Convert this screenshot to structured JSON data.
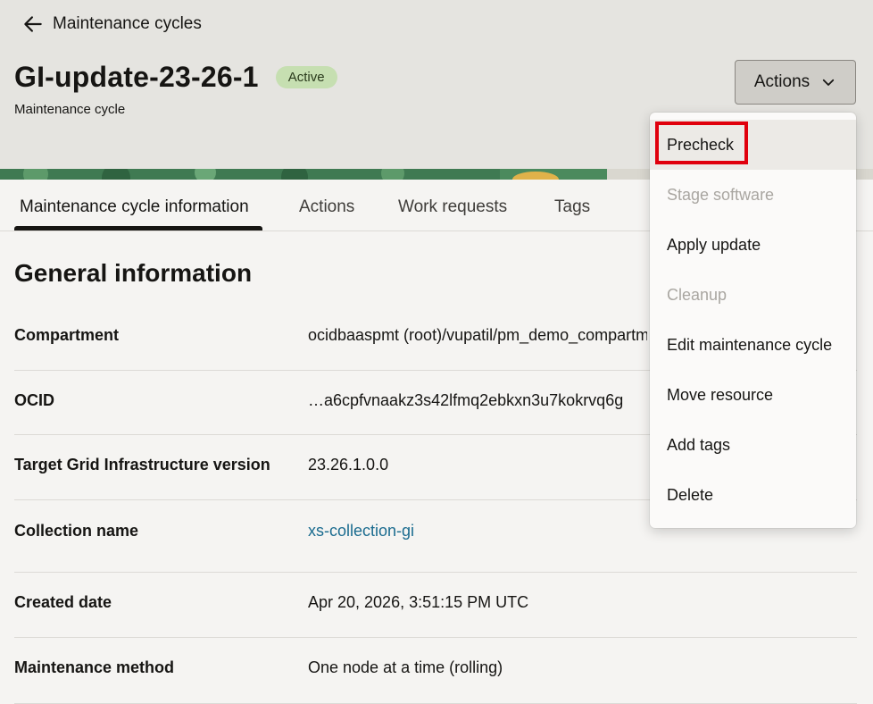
{
  "header": {
    "back_label": "Maintenance cycles",
    "title": "GI-update-23-26-1",
    "status": "Active",
    "subtitle": "Maintenance cycle",
    "actions_label": "Actions"
  },
  "tabs": [
    {
      "label": "Maintenance cycle information",
      "active": true
    },
    {
      "label": "Actions"
    },
    {
      "label": "Work requests"
    },
    {
      "label": "Tags"
    }
  ],
  "general": {
    "title": "General information",
    "rows": [
      {
        "label": "Compartment",
        "value": "ocidbaaspmt (root)/vupatil/pm_demo_compartment"
      },
      {
        "label": "OCID",
        "value": "…a6cpfvnaakz3s42lfmq2ebkxn3u7kokrvq6g"
      },
      {
        "label": "Target Grid Infrastructure version",
        "value": "23.26.1.0.0"
      },
      {
        "label": "Collection name",
        "value": "xs-collection-gi"
      },
      {
        "label": "Created date",
        "value": "Apr 20, 2026, 3:51:15 PM UTC"
      },
      {
        "label": "Maintenance method",
        "value": "One node at a time (rolling)"
      }
    ]
  },
  "menu": {
    "items": [
      {
        "label": "Precheck",
        "state": "highlighted"
      },
      {
        "label": "Stage software",
        "state": "disabled"
      },
      {
        "label": "Apply update",
        "state": "enabled"
      },
      {
        "label": "Cleanup",
        "state": "disabled"
      },
      {
        "label": "Edit maintenance cycle",
        "state": "enabled"
      },
      {
        "label": "Move resource",
        "state": "enabled"
      },
      {
        "label": "Add tags",
        "state": "enabled"
      },
      {
        "label": "Delete",
        "state": "enabled"
      }
    ]
  },
  "colors": {
    "header_bg": "#e5e4e0",
    "badge_bg": "#c6dfb1",
    "link": "#1a6b8f",
    "highlight_outline": "#e0000c",
    "banner_green": "#3f7a52"
  },
  "icons": {
    "back": "arrow-left-icon",
    "dropdown": "chevron-down-icon"
  }
}
